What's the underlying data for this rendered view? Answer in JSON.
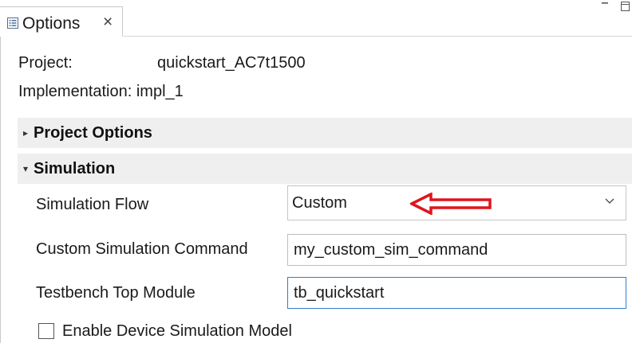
{
  "tab": {
    "label": "Options",
    "close": "×",
    "icon": "properties-icon"
  },
  "window_controls": {
    "minimize_icon": "minimize-icon",
    "maximize_icon": "maximize-icon"
  },
  "info": {
    "project_label": "Project:",
    "project_value": "quickstart_AC7t1500",
    "implementation_label": "Implementation: impl_1"
  },
  "sections": {
    "project_options": {
      "title": "Project Options",
      "expanded": false
    },
    "simulation": {
      "title": "Simulation",
      "expanded": true
    }
  },
  "simulation": {
    "flow_label": "Simulation Flow",
    "flow_value": "Custom",
    "custom_cmd_label": "Custom Simulation Command",
    "custom_cmd_value": "my_custom_sim_command",
    "tb_label": "Testbench Top Module",
    "tb_value": "tb_quickstart",
    "device_model_label": "Enable Device Simulation Model",
    "device_model_checked": false
  },
  "annotation": {
    "arrow_color": "#e0141e"
  },
  "colors": {
    "section_bg": "#efefef",
    "focus_border": "#2f7fd0"
  }
}
